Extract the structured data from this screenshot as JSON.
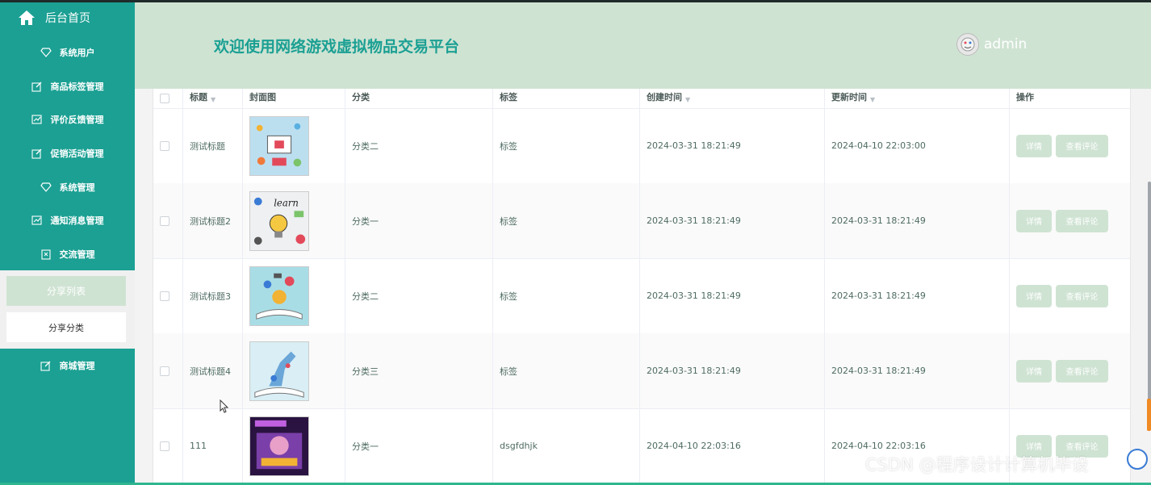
{
  "sidebar": {
    "home": "后台首页",
    "items": [
      {
        "label": "系统用户",
        "icon": "diamond-icon"
      },
      {
        "label": "商品标签管理",
        "icon": "edit-icon"
      },
      {
        "label": "评价反馈管理",
        "icon": "chart-icon"
      },
      {
        "label": "促销活动管理",
        "icon": "edit-icon"
      },
      {
        "label": "系统管理",
        "icon": "diamond-icon"
      },
      {
        "label": "通知消息管理",
        "icon": "chart-icon"
      },
      {
        "label": "交流管理",
        "icon": "doc-icon"
      }
    ],
    "sub_active": "分享列表",
    "sub_item": "分享分类",
    "mall": "商城管理"
  },
  "header": {
    "title": "欢迎使用网络游戏虚拟物品交易平台",
    "user": "admin"
  },
  "table": {
    "headers": {
      "title": "标题",
      "cover": "封面图",
      "category": "分类",
      "tag": "标签",
      "created": "创建时间",
      "updated": "更新时间",
      "actions": "操作"
    },
    "rows": [
      {
        "title": "测试标题",
        "category": "分类二",
        "tag": "标签",
        "created": "2024-03-31 18:21:49",
        "updated": "2024-04-10 22:03:00"
      },
      {
        "title": "测试标题2",
        "category": "分类一",
        "tag": "标签",
        "created": "2024-03-31 18:21:49",
        "updated": "2024-03-31 18:21:49"
      },
      {
        "title": "测试标题3",
        "category": "分类二",
        "tag": "标签",
        "created": "2024-03-31 18:21:49",
        "updated": "2024-03-31 18:21:49"
      },
      {
        "title": "测试标题4",
        "category": "分类三",
        "tag": "标签",
        "created": "2024-03-31 18:21:49",
        "updated": "2024-03-31 18:21:49"
      },
      {
        "title": "111",
        "category": "分类一",
        "tag": "dsgfdhjk",
        "created": "2024-04-10 22:03:16",
        "updated": "2024-04-10 22:03:16"
      }
    ],
    "detail_label": "详情",
    "review_label": "查看评论"
  },
  "watermark": "CSDN @程序设计计算机毕设",
  "colors": {
    "sidebar": "#1ba093",
    "header": "#cfe3d3",
    "accent": "#1ba093"
  }
}
